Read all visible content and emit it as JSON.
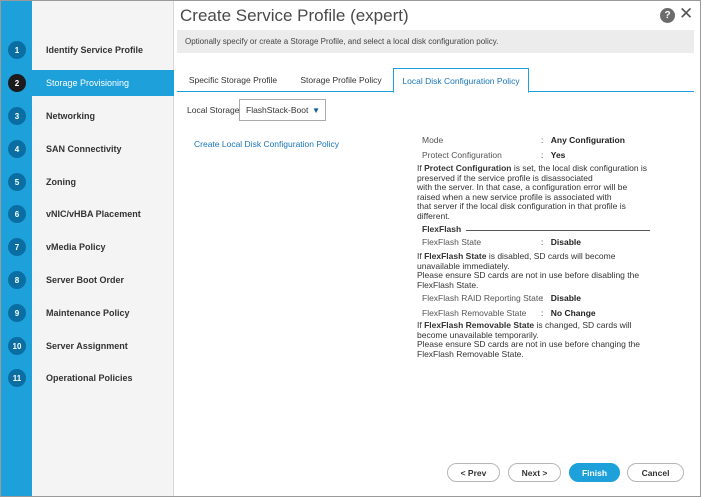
{
  "window": {
    "title": "Create Service Profile (expert)",
    "help_glyph": "?",
    "close_glyph": "✕"
  },
  "description": "Optionally specify or create a Storage Profile, and select a local disk configuration policy.",
  "steps": [
    {
      "num": "1",
      "label": "Identify Service Profile"
    },
    {
      "num": "2",
      "label": "Storage Provisioning"
    },
    {
      "num": "3",
      "label": "Networking"
    },
    {
      "num": "4",
      "label": "SAN Connectivity"
    },
    {
      "num": "5",
      "label": "Zoning"
    },
    {
      "num": "6",
      "label": "vNIC/vHBA Placement"
    },
    {
      "num": "7",
      "label": "vMedia Policy"
    },
    {
      "num": "8",
      "label": "Server Boot Order"
    },
    {
      "num": "9",
      "label": "Maintenance Policy"
    },
    {
      "num": "10",
      "label": "Server Assignment"
    },
    {
      "num": "11",
      "label": "Operational Policies"
    }
  ],
  "tabs": [
    {
      "label": "Specific Storage Profile"
    },
    {
      "label": "Storage Profile Policy"
    },
    {
      "label": "Local Disk Configuration Policy"
    }
  ],
  "local_storage": {
    "label": "Local Storage:",
    "value": "FlashStack-Boot",
    "caret": "▼"
  },
  "create_link": "Create Local Disk Configuration Policy",
  "details": {
    "mode": {
      "key": "Mode",
      "value": "Any Configuration"
    },
    "protect": {
      "key": "Protect Configuration",
      "value": "Yes"
    },
    "protect_note": {
      "pre": "If ",
      "bold": "Protect Configuration",
      "rest1": " is set, the local disk configuration is",
      "l2": "preserved if the service profile is disassociated",
      "l3": "with the server. In that case, a configuration error will be",
      "l4": "raised when a new service profile is associated with",
      "l5": "that server if the local disk configuration in that profile is",
      "l6": "different."
    },
    "flexflash_title": "FlexFlash",
    "flexflash_state": {
      "key": "FlexFlash State",
      "value": "Disable"
    },
    "flexflash_note": {
      "pre": "If ",
      "bold": "FlexFlash State",
      "rest1": " is disabled, SD cards will become",
      "l2": "unavailable immediately.",
      "l3": "Please ensure SD cards are not in use before disabling the",
      "l4": "FlexFlash State."
    },
    "raid_state": {
      "key": "FlexFlash RAID Reporting State",
      "value": "Disable"
    },
    "removable_state": {
      "key": "FlexFlash Removable State",
      "value": "No Change"
    },
    "removable_note": {
      "pre": "If ",
      "bold": "FlexFlash Removable State",
      "rest1": " is changed, SD cards will",
      "l2": "become unavailable temporarily.",
      "l3": "Please ensure SD cards are not in use before changing the",
      "l4": "FlexFlash Removable State."
    },
    "colon": ":"
  },
  "footer": {
    "prev": "< Prev",
    "next": "Next >",
    "finish": "Finish",
    "cancel": "Cancel"
  },
  "colors": {
    "accent": "#1ea1db",
    "step_circle": "#0b6ea3",
    "link": "#1a75b8"
  }
}
